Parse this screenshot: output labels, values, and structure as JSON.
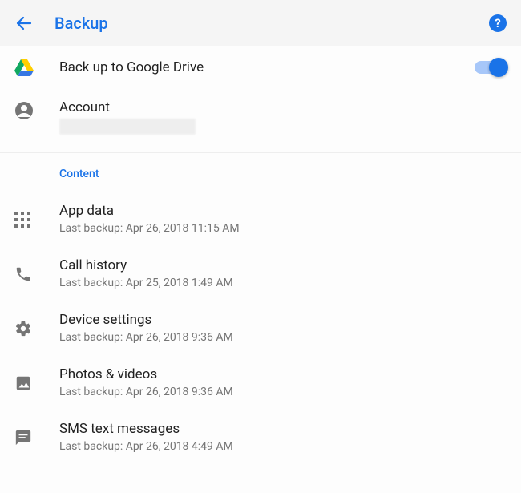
{
  "header": {
    "title": "Backup"
  },
  "backup_switch": {
    "label": "Back up to Google Drive",
    "on": true
  },
  "account": {
    "label": "Account",
    "value": ""
  },
  "content_section_label": "Content",
  "items": [
    {
      "icon": "apps",
      "title": "App data",
      "subtitle": "Last backup: Apr 26, 2018 11:15 AM"
    },
    {
      "icon": "phone",
      "title": "Call history",
      "subtitle": "Last backup: Apr 25, 2018 1:49 AM"
    },
    {
      "icon": "gear",
      "title": "Device settings",
      "subtitle": "Last backup: Apr 26, 2018 9:36 AM"
    },
    {
      "icon": "image",
      "title": "Photos & videos",
      "subtitle": "Last backup: Apr 26, 2018 9:36 AM"
    },
    {
      "icon": "message",
      "title": "SMS text messages",
      "subtitle": "Last backup: Apr 26, 2018 4:49 AM"
    }
  ]
}
